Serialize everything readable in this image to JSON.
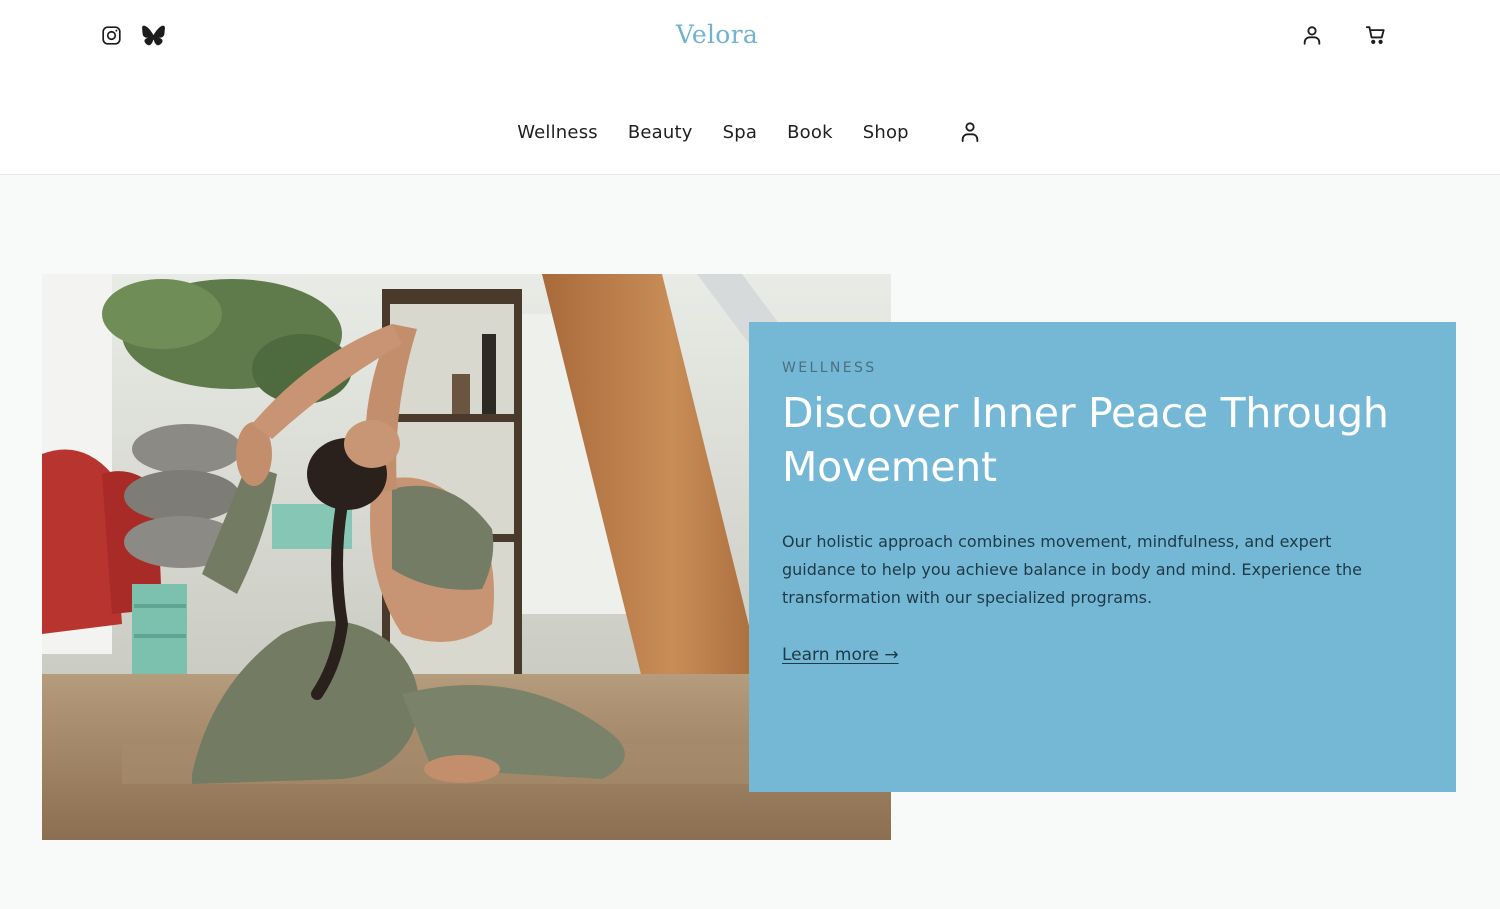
{
  "brand": {
    "name": "Velora",
    "color": "#6fb3cf"
  },
  "header": {
    "social_icons": [
      "instagram-icon",
      "bluesky-butterfly-icon"
    ],
    "utility_icons": [
      "account-icon",
      "cart-icon"
    ]
  },
  "nav": {
    "items": [
      {
        "label": "Wellness"
      },
      {
        "label": "Beauty"
      },
      {
        "label": "Spa"
      },
      {
        "label": "Book"
      },
      {
        "label": "Shop"
      }
    ],
    "account_icon": "account-icon"
  },
  "hero": {
    "eyebrow": "WELLNESS",
    "headline": "Discover Inner Peace Through Movement",
    "body": "Our holistic approach combines movement, mindfulness, and expert guidance to help you achieve balance in body and mind. Experience the transformation with our specialized programs.",
    "cta_label": "Learn more →",
    "card_color": "#75b8d5"
  }
}
